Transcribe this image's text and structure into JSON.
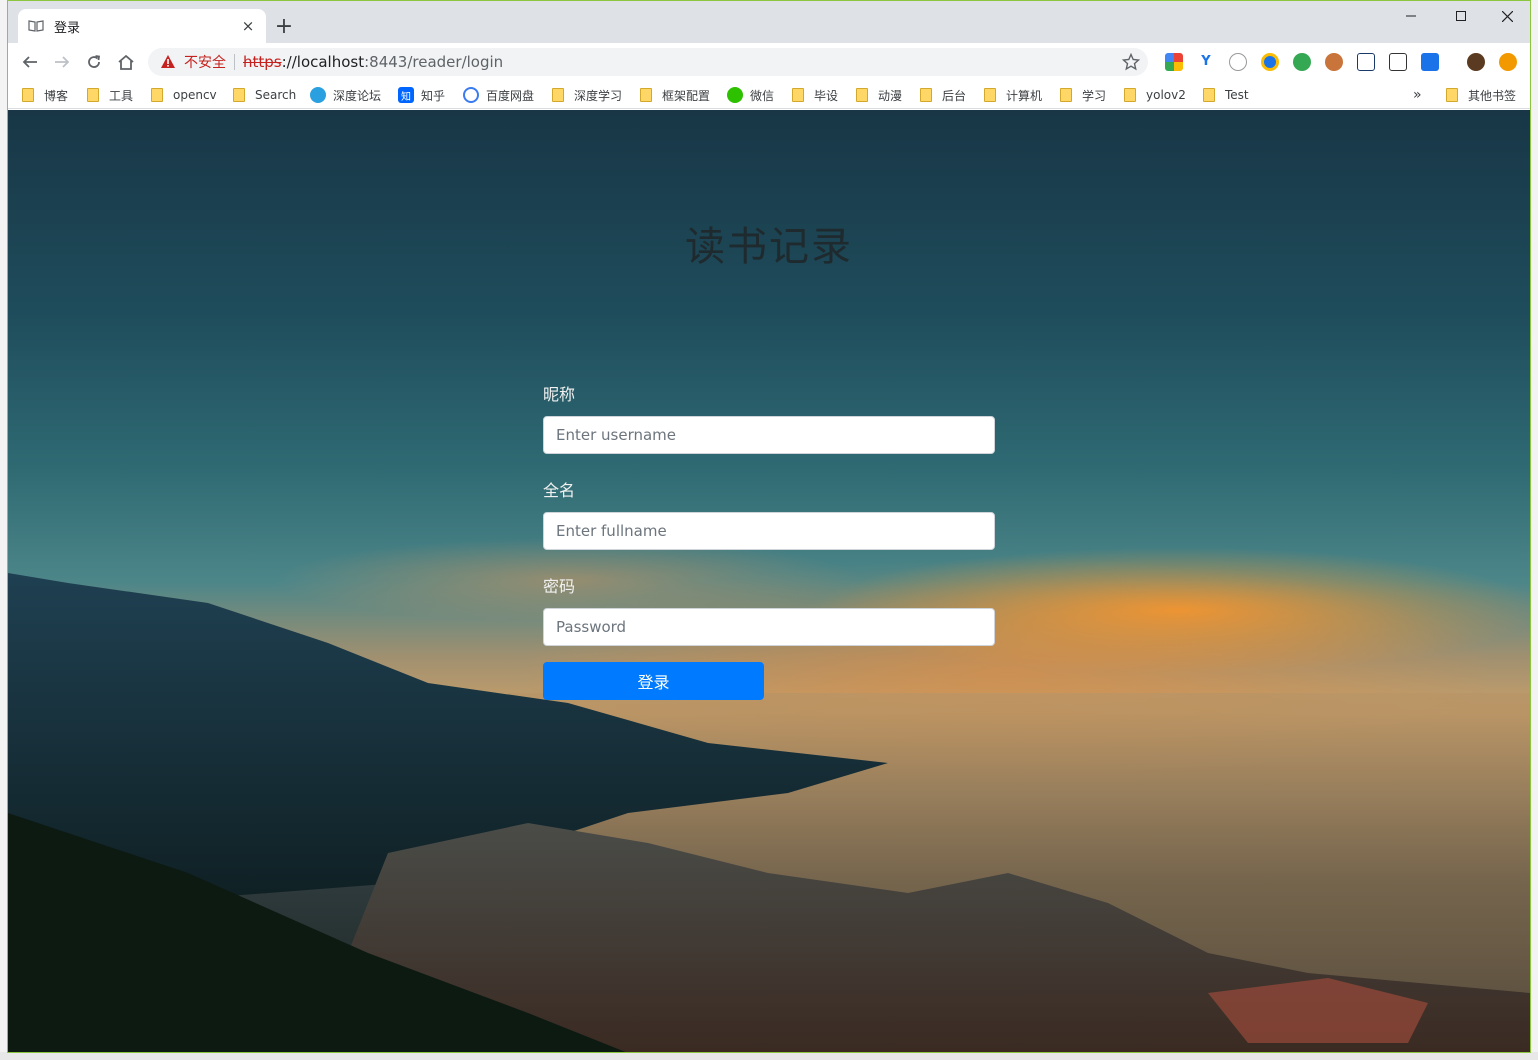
{
  "browser": {
    "tab": {
      "title": "登录",
      "close": "×"
    },
    "new_tab": "+",
    "window_controls": {
      "minimize": "—",
      "maximize": "☐",
      "close": "✕"
    },
    "address": {
      "security_label": "不安全",
      "scheme": "https",
      "host": "://localhost",
      "rest": ":8443/reader/login"
    },
    "overflow": "»",
    "bookmarks": [
      {
        "label": "博客",
        "kind": "folder"
      },
      {
        "label": "工具",
        "kind": "folder"
      },
      {
        "label": "opencv",
        "kind": "folder"
      },
      {
        "label": "Search",
        "kind": "folder"
      },
      {
        "label": "深度论坛",
        "kind": "site",
        "icon": "deepin-icon"
      },
      {
        "label": "知乎",
        "kind": "site",
        "icon": "zhihu-icon",
        "glyph": "知"
      },
      {
        "label": "百度网盘",
        "kind": "site",
        "icon": "baidu-pan-icon"
      },
      {
        "label": "深度学习",
        "kind": "folder"
      },
      {
        "label": "框架配置",
        "kind": "folder"
      },
      {
        "label": "微信",
        "kind": "site",
        "icon": "wechat-icon"
      },
      {
        "label": "毕设",
        "kind": "folder"
      },
      {
        "label": "动漫",
        "kind": "folder"
      },
      {
        "label": "后台",
        "kind": "folder"
      },
      {
        "label": "计算机",
        "kind": "folder"
      },
      {
        "label": "学习",
        "kind": "folder"
      },
      {
        "label": "yolov2",
        "kind": "folder"
      },
      {
        "label": "Test",
        "kind": "folder"
      }
    ],
    "other_bookmarks": "其他书签"
  },
  "page": {
    "title": "读书记录",
    "fields": {
      "nickname": {
        "label": "昵称",
        "placeholder": "Enter username"
      },
      "fullname": {
        "label": "全名",
        "placeholder": "Enter fullname"
      },
      "password": {
        "label": "密码",
        "placeholder": "Password"
      }
    },
    "submit_label": "登录"
  },
  "colors": {
    "primary": "#007bff",
    "insecure": "#c5221f",
    "window_border": "#8cc63f"
  }
}
